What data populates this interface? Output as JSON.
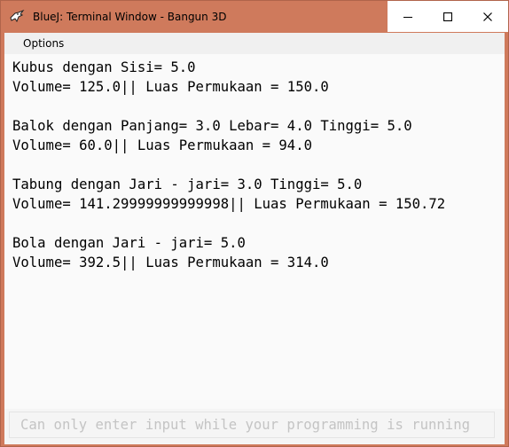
{
  "window": {
    "title": "BlueJ: Terminal Window - Bangun 3D",
    "icon": "bluej-bird-icon",
    "controls": {
      "minimize_icon": "minimize-icon",
      "maximize_icon": "maximize-icon",
      "close_icon": "close-icon"
    }
  },
  "menu": {
    "options_label": "Options"
  },
  "terminal": {
    "lines": [
      "Kubus dengan Sisi= 5.0",
      "Volume= 125.0|| Luas Permukaan = 150.0",
      "",
      "Balok dengan Panjang= 3.0 Lebar= 4.0 Tinggi= 5.0",
      "Volume= 60.0|| Luas Permukaan = 94.0",
      "",
      "Tabung dengan Jari - jari= 3.0 Tinggi= 5.0",
      "Volume= 141.29999999999998|| Luas Permukaan = 150.72",
      "",
      "Bola dengan Jari - jari= 5.0",
      "Volume= 392.5|| Luas Permukaan = 314.0"
    ]
  },
  "input": {
    "placeholder": "Can only enter input while your programming is running",
    "value": ""
  },
  "colors": {
    "titlebar": "#cf7a5c",
    "terminal_bg": "#fafafa",
    "menubar_bg": "#f0f0f0"
  }
}
